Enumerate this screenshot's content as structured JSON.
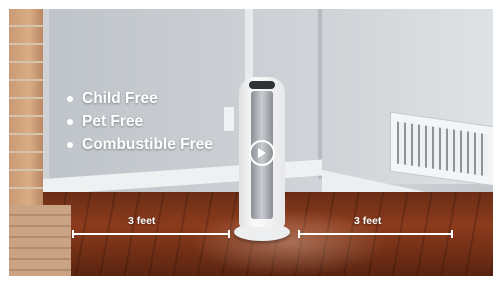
{
  "overlay": {
    "bullets": [
      {
        "label": "Child Free"
      },
      {
        "label": "Pet Free"
      },
      {
        "label": "Combustible Free"
      }
    ],
    "dimension_left": {
      "label": "3 feet"
    },
    "dimension_right": {
      "label": "3 feet"
    }
  },
  "icons": {
    "play": "play-icon"
  },
  "colors": {
    "overlay_text": "#ffffff",
    "floor": "#7a3218",
    "wall": "#c9cdd2"
  }
}
